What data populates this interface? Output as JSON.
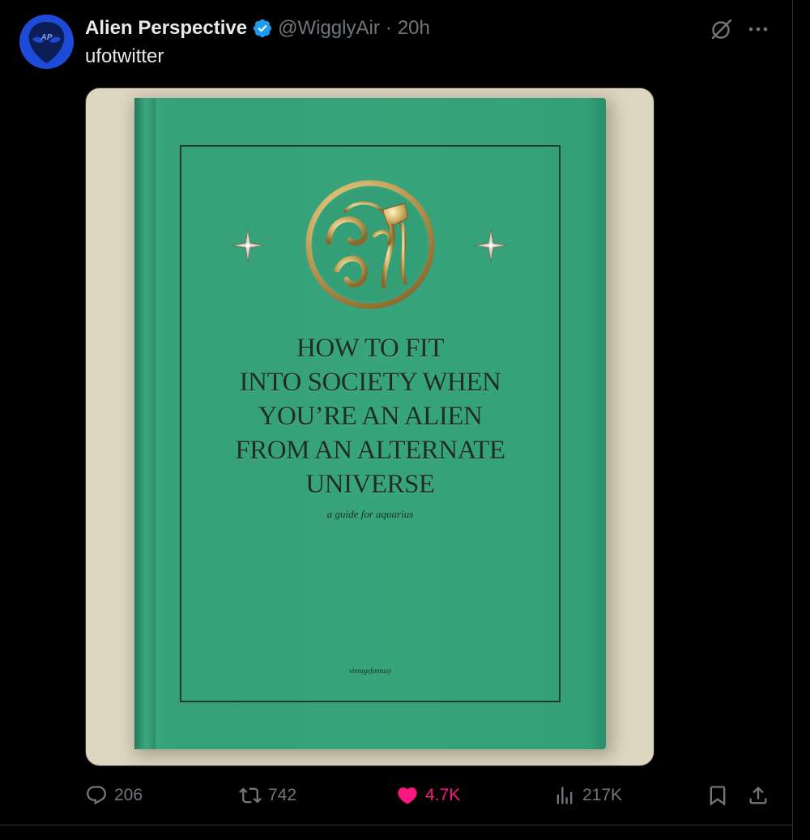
{
  "tweet": {
    "display_name": "Alien Perspective",
    "handle": "@WigglyAir",
    "separator": "·",
    "time": "20h",
    "text": "ufotwitter",
    "avatar_initials": "AP"
  },
  "media": {
    "book_title_lines": [
      "HOW TO FIT",
      "INTO SOCIETY WHEN",
      "YOU’RE AN ALIEN",
      "FROM AN ALTERNATE",
      "UNIVERSE"
    ],
    "book_subtitle": "a guide for aquarius",
    "book_credit": "vintagefantasy",
    "cover_color": "#38a47b"
  },
  "actions": {
    "replies": "206",
    "reposts": "742",
    "likes": "4.7K",
    "views": "217K"
  },
  "colors": {
    "background": "#000000",
    "text_primary": "#e7e9ea",
    "text_secondary": "#71767b",
    "like_active": "#f91880",
    "verified": "#1d9bf0",
    "divider": "#2f3336"
  },
  "icons": {
    "header": [
      "verified-badge-icon",
      "grok-icon",
      "more-icon"
    ],
    "actions": [
      "reply-icon",
      "retweet-icon",
      "heart-icon",
      "views-icon",
      "bookmark-icon",
      "share-icon"
    ]
  }
}
